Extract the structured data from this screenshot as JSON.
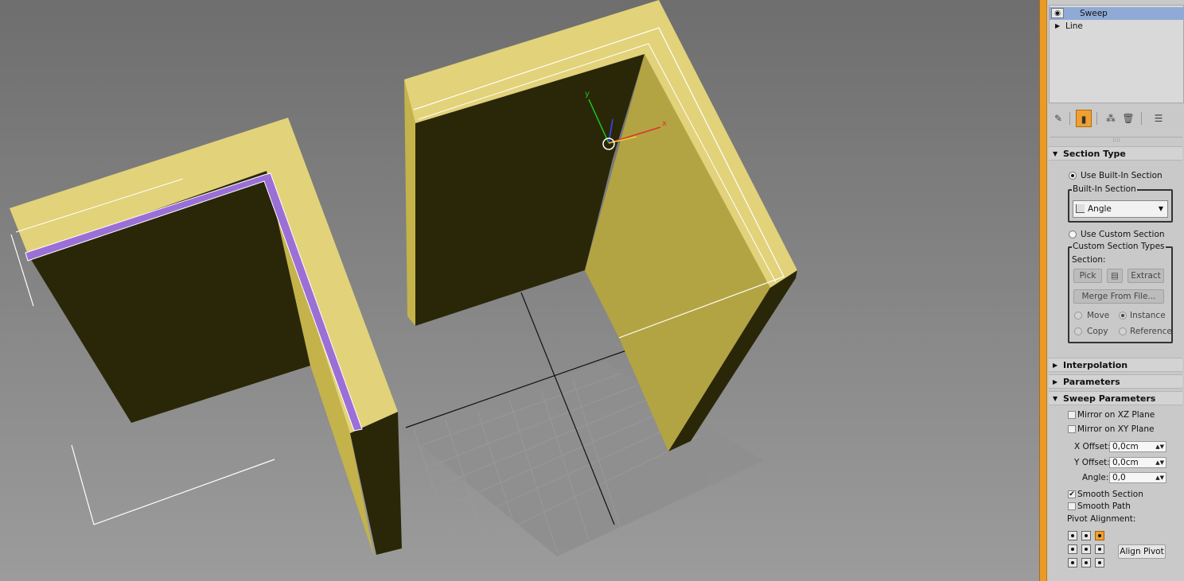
{
  "modifier_stack": {
    "items": [
      {
        "label": "Sweep",
        "selected": true,
        "icon": "eye-icon"
      },
      {
        "label": "Line",
        "selected": false,
        "icon": "expand-arrow-icon"
      }
    ]
  },
  "stack_toolbar": {
    "buttons": [
      "pin-stack-icon",
      "show-end-result-icon",
      "make-unique-icon",
      "remove-modifier-icon",
      "configure-modifier-sets-icon"
    ]
  },
  "section_type": {
    "title": "Section Type",
    "use_builtin_label": "Use Built-In Section",
    "builtin_group_title": "Built-In Section",
    "builtin_selected": "Angle",
    "use_custom_label": "Use Custom Section",
    "custom_group_title": "Custom Section Types",
    "section_label": "Section:",
    "pick_label": "Pick",
    "extract_label": "Extract",
    "merge_label": "Merge From File...",
    "move_label": "Move",
    "instance_label": "Instance",
    "copy_label": "Copy",
    "reference_label": "Reference"
  },
  "interpolation": {
    "title": "Interpolation"
  },
  "parameters": {
    "title": "Parameters"
  },
  "sweep_parameters": {
    "title": "Sweep Parameters",
    "mirror_xz_label": "Mirror on XZ Plane",
    "mirror_xy_label": "Mirror on XY Plane",
    "x_offset_label": "X Offset:",
    "x_offset_value": "0,0cm",
    "y_offset_label": "Y Offset:",
    "y_offset_value": "0,0cm",
    "angle_label": "Angle:",
    "angle_value": "0,0",
    "smooth_section_label": "Smooth Section",
    "smooth_section_checked": true,
    "smooth_path_label": "Smooth Path",
    "pivot_alignment_label": "Pivot Alignment:",
    "align_pivot_label": "Align Pivot"
  },
  "colors": {
    "wall_top": "#e2d27a",
    "wall_side": "#c8b850",
    "wall_dark": "#2a2708",
    "selection_purple": "#9b6fd6",
    "accent": "#ea9a26"
  },
  "gizmo": {
    "x_axis_label": "x",
    "y_axis_label": "y"
  }
}
